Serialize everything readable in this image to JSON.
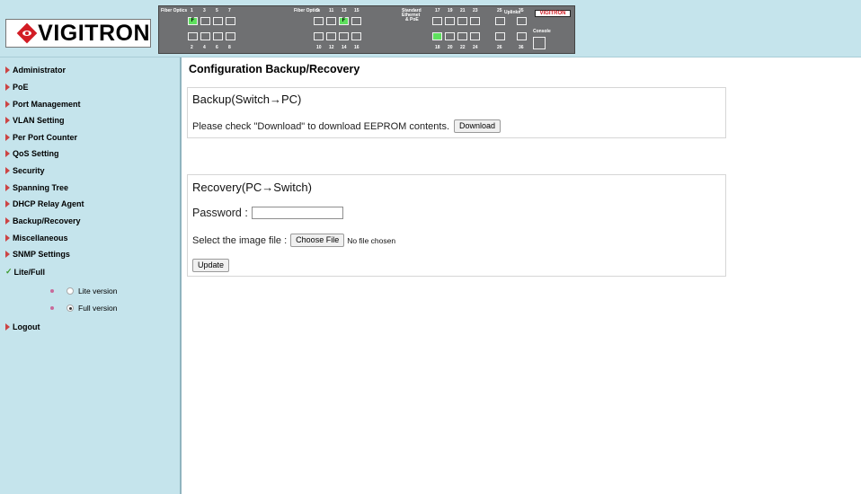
{
  "header": {
    "brand": "VIGITRON",
    "panel": {
      "fiber_label_1": "Fiber Optics",
      "fiber_label_2": "Fiber Optics",
      "std_label_1": "Standard",
      "std_label_2": "Ethernet",
      "std_label_3": "& PoE",
      "uplinks_label": "Uplinks",
      "console_label": "Console",
      "mini_logo": "VIGITRON",
      "top_nums_a": [
        "1",
        "3",
        "5",
        "7"
      ],
      "bot_nums_a": [
        "2",
        "4",
        "6",
        "8"
      ],
      "top_nums_b": [
        "9",
        "11",
        "13",
        "15"
      ],
      "bot_nums_b": [
        "10",
        "12",
        "14",
        "16"
      ],
      "top_nums_c": [
        "17",
        "19",
        "21",
        "23"
      ],
      "bot_nums_c": [
        "18",
        "20",
        "22",
        "24"
      ],
      "uplink_top": [
        "25",
        "35"
      ],
      "uplink_bot": [
        "26",
        "36"
      ],
      "active_port_marker": "F"
    }
  },
  "sidebar": {
    "items": [
      {
        "label": "Administrator"
      },
      {
        "label": "PoE"
      },
      {
        "label": "Port Management"
      },
      {
        "label": "VLAN Setting"
      },
      {
        "label": "Per Port Counter"
      },
      {
        "label": "QoS Setting"
      },
      {
        "label": "Security"
      },
      {
        "label": "Spanning Tree"
      },
      {
        "label": "DHCP Relay Agent"
      },
      {
        "label": "Backup/Recovery"
      },
      {
        "label": "Miscellaneous"
      },
      {
        "label": "SNMP Settings"
      },
      {
        "label": "Lite/Full"
      }
    ],
    "lite_label": "Lite version",
    "full_label": "Full version",
    "logout": "Logout"
  },
  "main": {
    "title": "Configuration Backup/Recovery",
    "backup": {
      "title": "Backup(Switch→PC)",
      "text": "Please check \"Download\" to download EEPROM contents.",
      "button": "Download"
    },
    "recovery": {
      "title": "Recovery(PC→Switch)",
      "password_label": "Password :",
      "file_label": "Select the image file :",
      "choose_button": "Choose File",
      "no_file": "No file chosen",
      "update_button": "Update"
    }
  }
}
